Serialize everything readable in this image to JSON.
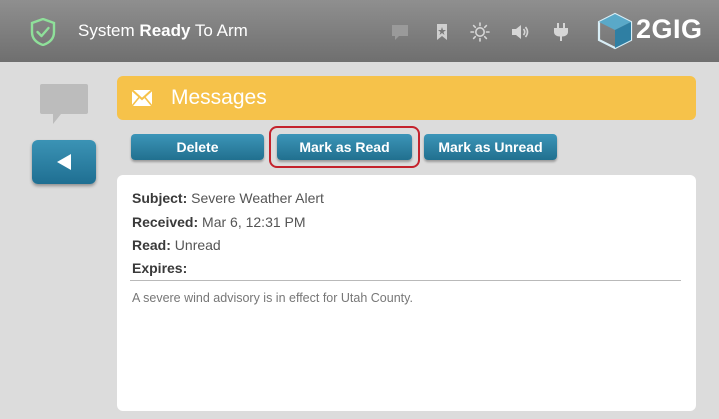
{
  "status": {
    "prefix": "System",
    "bold": "Ready",
    "suffix": "To Arm"
  },
  "status_icons": [
    "shield-check-icon",
    "chat-bubble-icon",
    "bookmark-icon",
    "brightness-icon",
    "volume-icon",
    "power-plug-icon"
  ],
  "brand": {
    "logo_text": "2GIG"
  },
  "header": {
    "title": "Messages",
    "icon": "envelope-icon"
  },
  "toolbar": {
    "delete_label": "Delete",
    "mark_read_label": "Mark as Read",
    "mark_unread_label": "Mark as Unread"
  },
  "message": {
    "subject_label": "Subject:",
    "subject": "Severe Weather Alert",
    "received_label": "Received:",
    "received": "Mar 6, 12:31 PM",
    "read_label": "Read:",
    "read": "Unread",
    "expires_label": "Expires:",
    "expires": "",
    "body": "A severe wind advisory is in effect for Utah County."
  },
  "colors": {
    "header": "#f6c24a",
    "button": "#2a7fa3",
    "status_bar": "#7f7f7f",
    "highlight": "#c4222c",
    "shield": "#7fd88c"
  }
}
